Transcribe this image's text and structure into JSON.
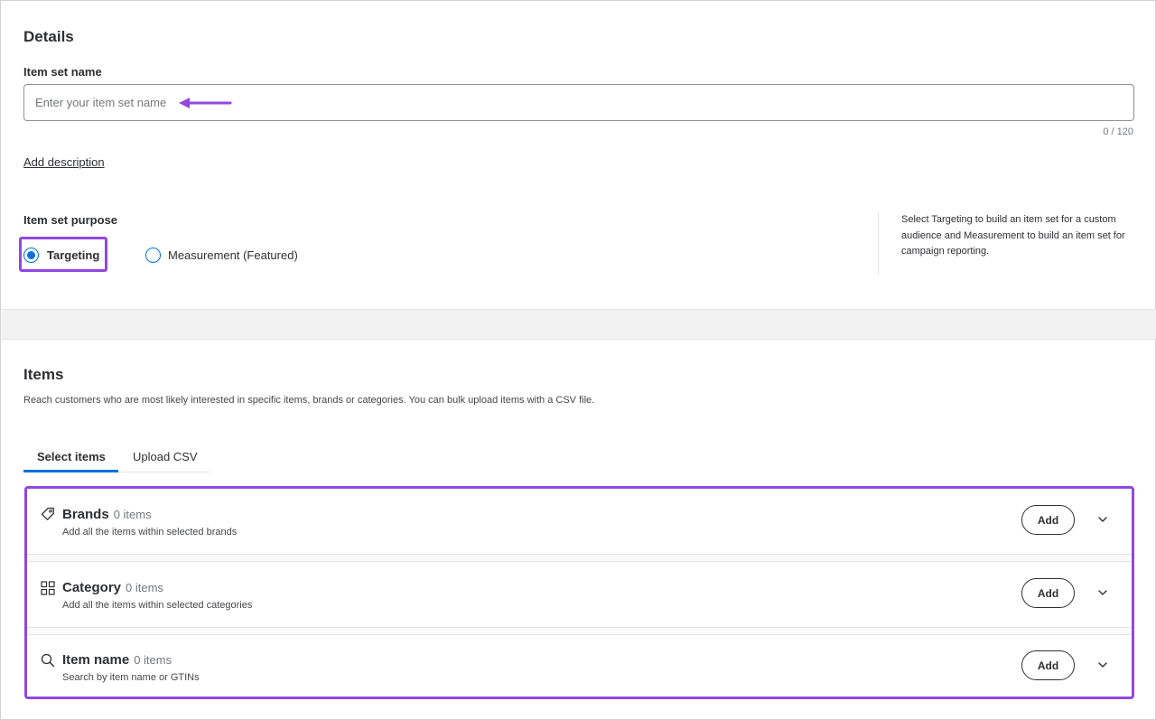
{
  "details": {
    "title": "Details",
    "item_set_name_label": "Item set name",
    "item_set_name_placeholder": "Enter your item set name",
    "item_set_name_value": "",
    "char_counter": "0 / 120",
    "add_description_link": "Add description",
    "purpose_label": "Item set purpose",
    "purpose_options": [
      {
        "label": "Targeting",
        "selected": true
      },
      {
        "label": "Measurement (Featured)",
        "selected": false
      }
    ],
    "purpose_help": "Select Targeting to build an item set for a custom audience and Measurement to build an item set for campaign reporting."
  },
  "items": {
    "title": "Items",
    "description": "Reach customers who are most likely interested in specific items, brands or categories. You can bulk upload items with a CSV file.",
    "tabs": [
      {
        "label": "Select items",
        "active": true
      },
      {
        "label": "Upload CSV",
        "active": false
      }
    ],
    "rows": [
      {
        "icon": "tag-icon",
        "title": "Brands",
        "count": "0 items",
        "subtitle": "Add all the items within selected brands",
        "button": "Add"
      },
      {
        "icon": "grid-icon",
        "title": "Category",
        "count": "0 items",
        "subtitle": "Add all the items within selected categories",
        "button": "Add"
      },
      {
        "icon": "search-icon",
        "title": "Item name",
        "count": "0 items",
        "subtitle": "Search by item name or GTINs",
        "button": "Add"
      }
    ]
  },
  "colors": {
    "highlight": "#9247e0",
    "accent": "#0071dc",
    "text": "#2e2f32"
  }
}
